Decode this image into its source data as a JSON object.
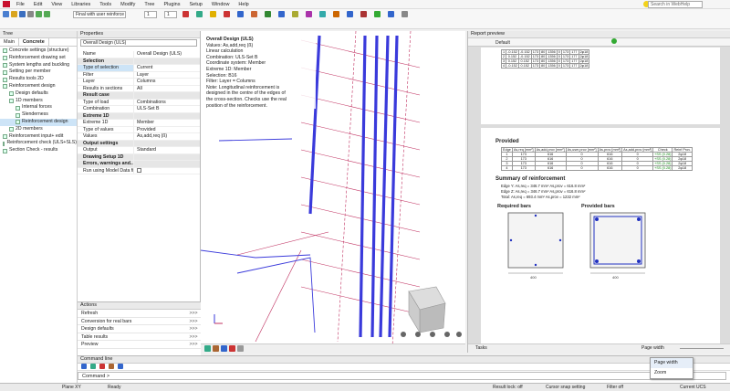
{
  "menu": [
    "File",
    "Edit",
    "View",
    "Libraries",
    "Tools",
    "Modify",
    "Tree",
    "Plugins",
    "Setup",
    "Window",
    "Help"
  ],
  "toolbar": {
    "combo1": "Final with user reinforce",
    "combo2": "1",
    "combo3": "1",
    "search_placeholder": "Search in WebHelp"
  },
  "tree": {
    "title": "Tree",
    "tabs": [
      "Main",
      "Concrete"
    ],
    "items": [
      "Concrete settings (structure)",
      "Reinforcement drawing set",
      "System lengths and buckling",
      "Setting per member",
      "Results tools 2D",
      "Reinforcement design",
      "Design defaults",
      "1D members",
      "Internal forces",
      "Slenderness",
      "Reinforcement design",
      "2D members",
      "Reinforcement input+ edit",
      "Reinforcement check (ULS+SLS)",
      "Section Check - results"
    ]
  },
  "properties": {
    "title": "Properties",
    "combo": "Overall Design (ULS)",
    "rows": [
      {
        "k": "Name",
        "v": "Overall Design (ULS)",
        "sec": false
      },
      {
        "k": "Selection",
        "v": "",
        "sec": true
      },
      {
        "k": "Type of selection",
        "v": "Current",
        "sec": false
      },
      {
        "k": "Filter",
        "v": "Layer",
        "sec": false
      },
      {
        "k": "Layer",
        "v": "Columns",
        "sec": false
      },
      {
        "k": "Results in sections",
        "v": "All",
        "sec": false
      },
      {
        "k": "Result case",
        "v": "",
        "sec": true
      },
      {
        "k": "Type of load",
        "v": "Combinations",
        "sec": false
      },
      {
        "k": "Combination",
        "v": "ULS-Set B",
        "sec": false
      },
      {
        "k": "Extreme 1D",
        "v": "",
        "sec": true
      },
      {
        "k": "Extreme 1D",
        "v": "Member",
        "sec": false
      },
      {
        "k": "Type of values",
        "v": "Provided",
        "sec": false
      },
      {
        "k": "Values",
        "v": "As,add,req (ß)",
        "sec": false
      },
      {
        "k": "Output settings",
        "v": "",
        "sec": true
      },
      {
        "k": "Output",
        "v": "Standard",
        "sec": false
      },
      {
        "k": "Drawing Setup 1D",
        "v": "",
        "sec": true
      },
      {
        "k": "Errors, warnings and...",
        "v": "",
        "sec": true
      },
      {
        "k": "Run using Model Data file...",
        "v": "",
        "sec": false
      }
    ]
  },
  "actions": {
    "title": "Actions",
    "items": [
      "Refresh",
      "Conversion for real bars",
      "Design defaults",
      "Table results",
      "Preview"
    ],
    "btn": ">>>"
  },
  "view": {
    "info": [
      "Overall Design (ULS)",
      "Values: As,add,req (ß)",
      "Linear calculation",
      "Combination: ULS-Set B",
      "Coordinate system: Member",
      "Extreme 1D: Member",
      "Selection: B16",
      "Filter: Layer = Columns",
      "Note: Longitudinal reinforcement is",
      "designed in the centre of the edges of",
      "the cross-section. Checks use the real",
      "position of the reinforcement."
    ]
  },
  "report": {
    "title": "Report preview",
    "default": "Default",
    "top_rows": [
      [
        "1",
        "-0.152",
        "-0.152",
        "173",
        "80",
        "1356",
        "0",
        "173",
        "177",
        "2φ18"
      ],
      [
        "2",
        "0.152",
        "-0.152",
        "173",
        "80",
        "1356",
        "0",
        "173",
        "177",
        "2φ18"
      ],
      [
        "3",
        "0.152",
        "0.152",
        "173",
        "80",
        "1356",
        "0",
        "173",
        "177",
        "2φ18"
      ],
      [
        "4",
        "-0.152",
        "0.152",
        "173",
        "80",
        "1356",
        "0",
        "173",
        "177",
        "2φ18"
      ]
    ],
    "provided_title": "Provided",
    "provided_head": [
      "Edge",
      "As,req [mm²]",
      "As,add,prov [mm²]",
      "As,user,prov [mm²]",
      "As,prov [mm²]",
      "As,add,prov [mm²]",
      "Check",
      "Reinf Prov."
    ],
    "provided_rows": [
      [
        "1",
        "173",
        "616",
        "0",
        "616",
        "0",
        "+SS (0.28)",
        "2φ18"
      ],
      [
        "2",
        "173",
        "616",
        "0",
        "616",
        "0",
        "+SS (0.28)",
        "2φ18"
      ],
      [
        "3",
        "173",
        "616",
        "0",
        "616",
        "0",
        "+SS (0.28)",
        "2φ18"
      ],
      [
        "4",
        "173",
        "616",
        "0",
        "616",
        "0",
        "+SS (0.28)",
        "2φ18"
      ]
    ],
    "summary_title": "Summary of reinforcement",
    "summary": [
      "Edge Y:  As,req = 346.7 mm²   As,prov = 616.8 mm²",
      "Edge Z:  As,req = 346.7 mm²   As,prov = 616.8 mm²",
      "Total:   As,req = 693.4 mm²   As,prov = 1232 mm²"
    ],
    "req_bars": "Required bars",
    "prov_bars": "Provided bars",
    "dim": "400",
    "zoom_label": "Page width",
    "tasks": "Tasks"
  },
  "dropdown": [
    "Page width",
    "Zoom"
  ],
  "command": {
    "title": "Command line",
    "prompt": "Command >"
  },
  "status": {
    "plane": "Plane XY",
    "ready": "Ready",
    "result_lock": "Result lock: off",
    "cursor": "Cursor snap setting",
    "filter": "Filter off",
    "ucs": "Current UCS"
  },
  "colors": {
    "accent": "#1f5fbf",
    "rebar_blue": "#3a3adb",
    "stirrup": "#c03060",
    "ok": "#1a8f1a"
  }
}
